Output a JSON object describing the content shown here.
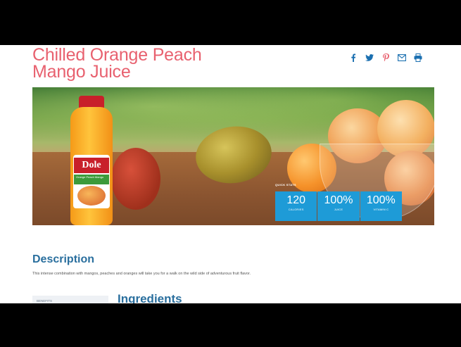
{
  "product": {
    "title_line1": "Chilled Orange Peach",
    "title_line2": "Mango Juice"
  },
  "share": {
    "icons": [
      "facebook-icon",
      "twitter-icon",
      "pinterest-icon",
      "email-icon",
      "print-icon"
    ],
    "icon_color": "#1a6fb0"
  },
  "bottle": {
    "brand": "Dole",
    "flavor_label": "Orange Peach Mango"
  },
  "quick_stats": {
    "label": "QUICK STATS",
    "items": [
      {
        "value": "120",
        "unit": "CALORIES"
      },
      {
        "value": "100%",
        "unit": "JUICE"
      },
      {
        "value": "100%",
        "unit": "VITAMIN C"
      }
    ],
    "accent": "#1e9bd7"
  },
  "description": {
    "heading": "Description",
    "text": "This intense combination with mangos, peaches and oranges will take you for a walk on the wild side of adventurous fruit flavor."
  },
  "tabs": {
    "active": "BENEFITS"
  },
  "ingredients": {
    "heading": "Ingredients"
  },
  "colors": {
    "title": "#e8616f",
    "heading": "#2a6f9e"
  }
}
